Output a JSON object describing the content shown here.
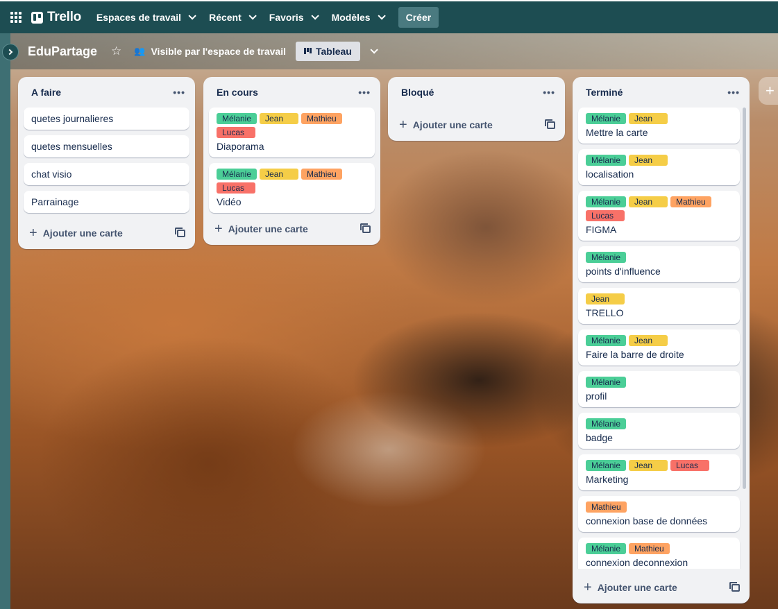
{
  "topbar": {
    "logo": "Trello",
    "nav": [
      "Espaces de travail",
      "Récent",
      "Favoris",
      "Modèles"
    ],
    "create": "Créer"
  },
  "board": {
    "title": "EduPartage",
    "visibility": "Visible par l'espace de travail",
    "view": "Tableau"
  },
  "lists": [
    {
      "title": "A faire",
      "add": "Ajouter une carte",
      "cards": [
        {
          "title": "quetes journalieres",
          "labels": []
        },
        {
          "title": "quetes mensuelles",
          "labels": []
        },
        {
          "title": "chat visio",
          "labels": []
        },
        {
          "title": "Parrainage",
          "labels": []
        }
      ]
    },
    {
      "title": "En cours",
      "add": "Ajouter une carte",
      "cards": [
        {
          "title": "Diaporama",
          "labels": [
            [
              "Mélanie",
              "green"
            ],
            [
              "Jean",
              "yellow"
            ],
            [
              "Mathieu",
              "orange"
            ],
            [
              "Lucas",
              "red"
            ]
          ]
        },
        {
          "title": "Vidéo",
          "labels": [
            [
              "Mélanie",
              "green"
            ],
            [
              "Jean",
              "yellow"
            ],
            [
              "Mathieu",
              "orange"
            ],
            [
              "Lucas",
              "red"
            ]
          ]
        }
      ]
    },
    {
      "title": "Bloqué",
      "add": "Ajouter une carte",
      "cards": []
    },
    {
      "title": "Terminé",
      "add": "Ajouter une carte",
      "cards": [
        {
          "title": "Mettre la carte",
          "labels": [
            [
              "Mélanie",
              "green"
            ],
            [
              "Jean",
              "yellow"
            ]
          ]
        },
        {
          "title": "localisation",
          "labels": [
            [
              "Mélanie",
              "green"
            ],
            [
              "Jean",
              "yellow"
            ]
          ]
        },
        {
          "title": "FIGMA",
          "labels": [
            [
              "Mélanie",
              "green"
            ],
            [
              "Jean",
              "yellow"
            ],
            [
              "Mathieu",
              "orange"
            ],
            [
              "Lucas",
              "red"
            ]
          ]
        },
        {
          "title": "points d'influence",
          "labels": [
            [
              "Mélanie",
              "green"
            ]
          ]
        },
        {
          "title": "TRELLO",
          "labels": [
            [
              "Jean",
              "yellow"
            ]
          ]
        },
        {
          "title": "Faire la barre de droite",
          "labels": [
            [
              "Mélanie",
              "green"
            ],
            [
              "Jean",
              "yellow"
            ]
          ]
        },
        {
          "title": "profil",
          "labels": [
            [
              "Mélanie",
              "green"
            ]
          ]
        },
        {
          "title": "badge",
          "labels": [
            [
              "Mélanie",
              "green"
            ]
          ]
        },
        {
          "title": "Marketing",
          "labels": [
            [
              "Mélanie",
              "green"
            ],
            [
              "Jean",
              "yellow"
            ],
            [
              "Lucas",
              "red"
            ]
          ]
        },
        {
          "title": "connexion base de données",
          "labels": [
            [
              "Mathieu",
              "orange"
            ]
          ]
        },
        {
          "title": "connexion deconnexion inscription",
          "labels": [
            [
              "Mélanie",
              "green"
            ],
            [
              "Mathieu",
              "orange"
            ]
          ]
        }
      ]
    }
  ]
}
